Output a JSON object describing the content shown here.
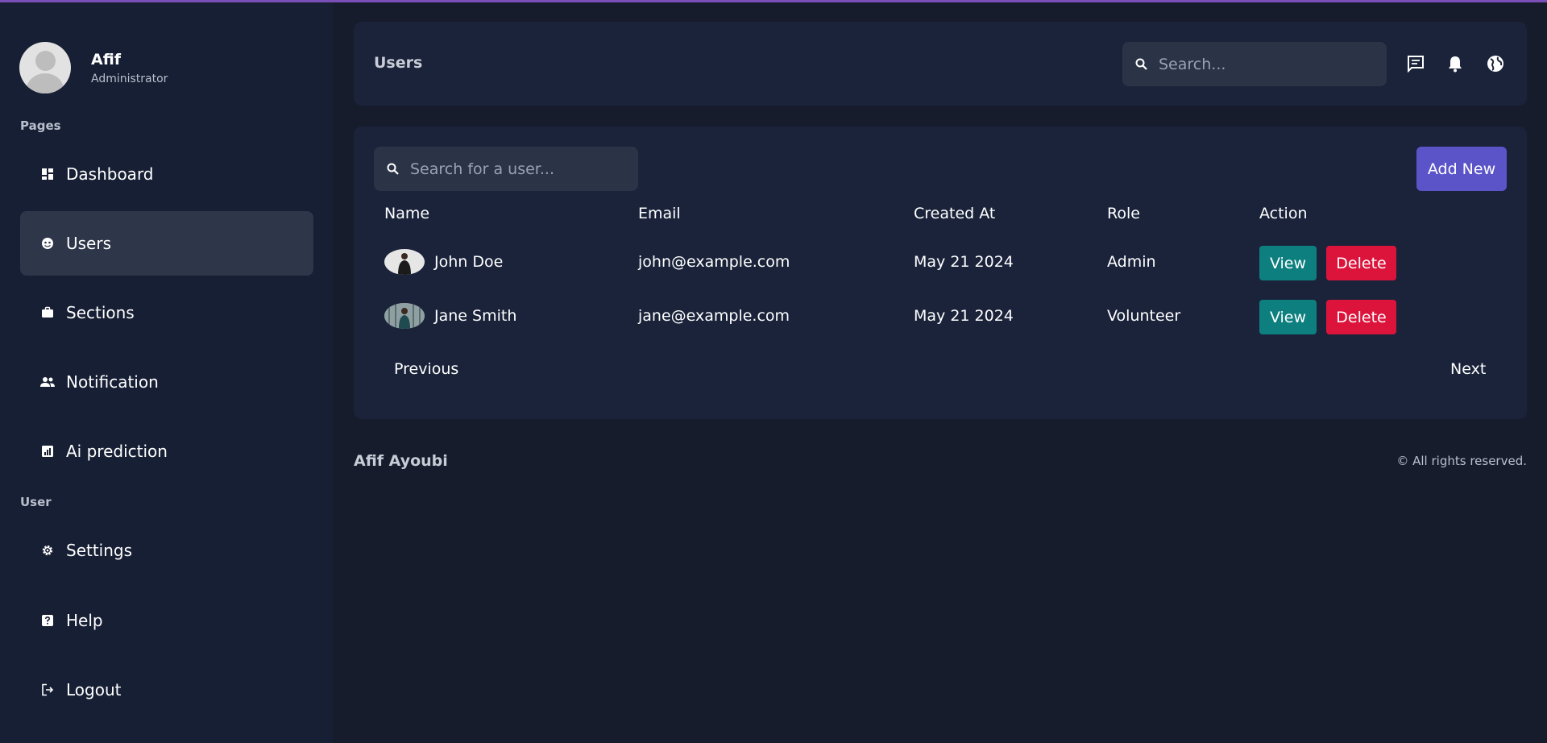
{
  "profile": {
    "name": "Afif",
    "role": "Administrator"
  },
  "sidebar": {
    "pages_label": "Pages",
    "user_label": "User",
    "items": [
      {
        "label": "Dashboard",
        "icon": "dashboard-icon"
      },
      {
        "label": "Users",
        "icon": "users-icon",
        "active": true
      },
      {
        "label": "Sections",
        "icon": "briefcase-icon"
      },
      {
        "label": "Notification",
        "icon": "people-icon"
      },
      {
        "label": "Ai prediction",
        "icon": "chart-icon"
      },
      {
        "label": "Settings",
        "icon": "gear-icon"
      },
      {
        "label": "Help",
        "icon": "help-icon"
      },
      {
        "label": "Logout",
        "icon": "logout-icon"
      }
    ]
  },
  "header": {
    "title": "Users",
    "search_placeholder": "Search...",
    "icons": [
      "chat-icon",
      "bell-icon",
      "globe-icon"
    ]
  },
  "users": {
    "search_placeholder": "Search for a user...",
    "add_label": "Add New",
    "columns": [
      "Name",
      "Email",
      "Created At",
      "Role",
      "Action"
    ],
    "rows": [
      {
        "name": "John Doe",
        "email": "john@example.com",
        "created_at": "May 21 2024",
        "role": "Admin",
        "view": "View",
        "delete": "Delete"
      },
      {
        "name": "Jane Smith",
        "email": "jane@example.com",
        "created_at": "May 21 2024",
        "role": "Volunteer",
        "view": "View",
        "delete": "Delete"
      }
    ],
    "prev_label": "Previous",
    "next_label": "Next"
  },
  "footer": {
    "name": "Afif Ayoubi",
    "copyright": "© All rights reserved."
  },
  "colors": {
    "accent": "#5b54c9",
    "view": "#0e7f7f",
    "delete": "#dc143c",
    "background": "#161c2c",
    "card": "#1a233a"
  }
}
